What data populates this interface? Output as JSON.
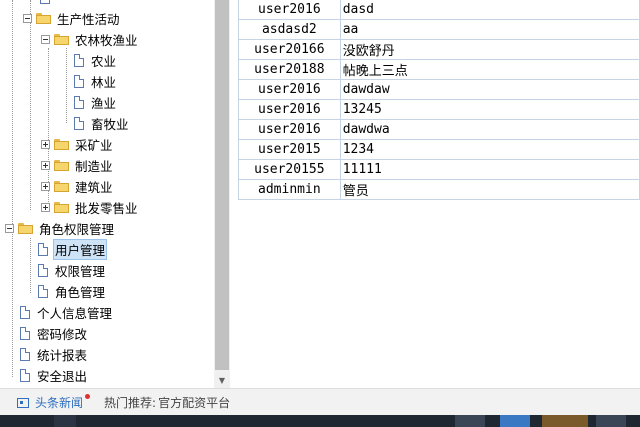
{
  "tree": {
    "items": [
      {
        "label": "生产性活动",
        "type": "folder",
        "expanded": true
      },
      {
        "label": "农林牧渔业",
        "type": "folder",
        "expanded": true
      },
      {
        "label": "农业",
        "type": "file"
      },
      {
        "label": "林业",
        "type": "file"
      },
      {
        "label": "渔业",
        "type": "file"
      },
      {
        "label": "畜牧业",
        "type": "file"
      },
      {
        "label": "采矿业",
        "type": "folder",
        "expanded": false
      },
      {
        "label": "制造业",
        "type": "folder",
        "expanded": false
      },
      {
        "label": "建筑业",
        "type": "folder",
        "expanded": false
      },
      {
        "label": "批发零售业",
        "type": "folder",
        "expanded": false
      },
      {
        "label": "角色权限管理",
        "type": "folder",
        "expanded": true
      },
      {
        "label": "用户管理",
        "type": "file",
        "selected": true
      },
      {
        "label": "权限管理",
        "type": "file"
      },
      {
        "label": "角色管理",
        "type": "file"
      },
      {
        "label": "个人信息管理",
        "type": "file"
      },
      {
        "label": "密码修改",
        "type": "file"
      },
      {
        "label": "统计报表",
        "type": "file"
      },
      {
        "label": "安全退出",
        "type": "file"
      }
    ]
  },
  "table": {
    "rows": [
      [
        "user2016",
        "dasd"
      ],
      [
        "asdasd2",
        "aa"
      ],
      [
        "user20166",
        "没欧舒丹"
      ],
      [
        "user20188",
        "帖晚上三点"
      ],
      [
        "user2016",
        "dawdaw"
      ],
      [
        "user2016",
        "13245"
      ],
      [
        "user2016",
        "dawdwa"
      ],
      [
        "user2015",
        "1234"
      ],
      [
        "user20155",
        "11111"
      ],
      [
        "adminmin",
        "管员"
      ]
    ]
  },
  "statusbar": {
    "news_label": "头条新闻",
    "hot_label": "热门推荐:",
    "hot_value": "官方配资平台"
  },
  "colors": {
    "accent": "#2f6fc0",
    "selection": "#cfe3f7",
    "grid": "#c6d4e6"
  }
}
